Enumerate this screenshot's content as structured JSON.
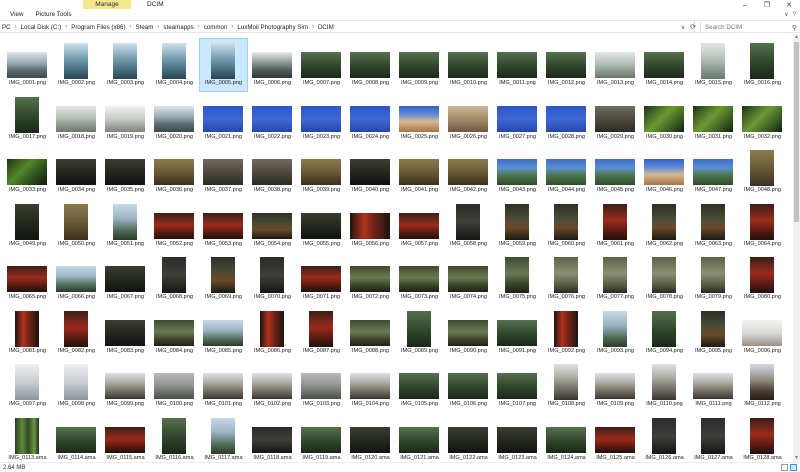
{
  "window": {
    "manage_tab": "Manage",
    "title": "DCIM",
    "minimize": "–",
    "maximize": "❐",
    "close": "✕"
  },
  "ribbon": {
    "tabs": [
      "View",
      "Picture Tools"
    ],
    "collapse": "∨",
    "help": "?"
  },
  "address": {
    "crumbs": [
      "PC",
      "Local Disk (C:)",
      "Program Files (x86)",
      "Steam",
      "steamapps",
      "common",
      "LuxMoil Photography Sim",
      "DCIM"
    ],
    "separator": "›",
    "dropdown": "∨",
    "refresh": "⟳"
  },
  "search": {
    "placeholder": "Search DCIM"
  },
  "status": {
    "text": "2.64 MB"
  },
  "files": [
    {
      "name": "IMG_0001.png",
      "theme": "city",
      "o": "land"
    },
    {
      "name": "IMG_0002.png",
      "theme": "water",
      "o": "port"
    },
    {
      "name": "IMG_0003.png",
      "theme": "water",
      "o": "port"
    },
    {
      "name": "IMG_0004.png",
      "theme": "water",
      "o": "port"
    },
    {
      "name": "IMG_0005.png",
      "theme": "water",
      "o": "port"
    },
    {
      "name": "IMG_0006.png",
      "theme": "dock",
      "o": "land"
    },
    {
      "name": "IMG_0007.png",
      "theme": "forest",
      "o": "land"
    },
    {
      "name": "IMG_0008.png",
      "theme": "forest",
      "o": "land"
    },
    {
      "name": "IMG_0009.png",
      "theme": "forest",
      "o": "land"
    },
    {
      "name": "IMG_0010.png",
      "theme": "forest",
      "o": "land"
    },
    {
      "name": "IMG_0011.png",
      "theme": "forest",
      "o": "land"
    },
    {
      "name": "IMG_0012.png",
      "theme": "forest",
      "o": "land"
    },
    {
      "name": "IMG_0013.png",
      "theme": "fog",
      "o": "land"
    },
    {
      "name": "IMG_0014.png",
      "theme": "forest",
      "o": "land"
    },
    {
      "name": "IMG_0015.png",
      "theme": "fog",
      "o": "port"
    },
    {
      "name": "IMG_0016.png",
      "theme": "forest",
      "o": "port"
    },
    {
      "name": "IMG_0017.png",
      "theme": "forest",
      "o": "port"
    },
    {
      "name": "IMG_0018.png",
      "theme": "fog",
      "o": "land"
    },
    {
      "name": "IMG_0019.png",
      "theme": "pale",
      "o": "land"
    },
    {
      "name": "IMG_0020.png",
      "theme": "city",
      "o": "land"
    },
    {
      "name": "IMG_0021.png",
      "theme": "blue",
      "o": "land"
    },
    {
      "name": "IMG_0022.png",
      "theme": "blue",
      "o": "land"
    },
    {
      "name": "IMG_0023.png",
      "theme": "blue",
      "o": "land"
    },
    {
      "name": "IMG_0024.png",
      "theme": "blue",
      "o": "land"
    },
    {
      "name": "IMG_0025.png",
      "theme": "beach",
      "o": "land"
    },
    {
      "name": "IMG_0026.png",
      "theme": "sand",
      "o": "land"
    },
    {
      "name": "IMG_0027.png",
      "theme": "blue",
      "o": "land"
    },
    {
      "name": "IMG_0028.png",
      "theme": "blue",
      "o": "land"
    },
    {
      "name": "IMG_0029.png",
      "theme": "ruins",
      "o": "land"
    },
    {
      "name": "IMG_0030.png",
      "theme": "palm",
      "o": "land"
    },
    {
      "name": "IMG_0031.png",
      "theme": "palm",
      "o": "land"
    },
    {
      "name": "IMG_0032.png",
      "theme": "palm",
      "o": "land"
    },
    {
      "name": "IMG_0033.png",
      "theme": "grass",
      "o": "land"
    },
    {
      "name": "IMG_0034.png",
      "theme": "dark",
      "o": "land"
    },
    {
      "name": "IMG_0035.png",
      "theme": "dark",
      "o": "land"
    },
    {
      "name": "IMG_0036.png",
      "theme": "dry",
      "o": "land"
    },
    {
      "name": "IMG_0037.png",
      "theme": "ruins",
      "o": "land"
    },
    {
      "name": "IMG_0038.png",
      "theme": "ruins",
      "o": "land"
    },
    {
      "name": "IMG_0039.png",
      "theme": "dry",
      "o": "land"
    },
    {
      "name": "IMG_0040.png",
      "theme": "dark",
      "o": "land"
    },
    {
      "name": "IMG_0041.png",
      "theme": "dry",
      "o": "land"
    },
    {
      "name": "IMG_0042.png",
      "theme": "dry",
      "o": "land"
    },
    {
      "name": "IMG_0043.png",
      "theme": "coast",
      "o": "land"
    },
    {
      "name": "IMG_0044.png",
      "theme": "coast",
      "o": "land"
    },
    {
      "name": "IMG_0045.png",
      "theme": "coast",
      "o": "land"
    },
    {
      "name": "IMG_0046.png",
      "theme": "beach",
      "o": "land"
    },
    {
      "name": "IMG_0047.png",
      "theme": "coast",
      "o": "land"
    },
    {
      "name": "IMG_0048.png",
      "theme": "dry",
      "o": "port"
    },
    {
      "name": "IMG_0049.png",
      "theme": "dark",
      "o": "port"
    },
    {
      "name": "IMG_0050.png",
      "theme": "dry",
      "o": "port"
    },
    {
      "name": "IMG_0051.png",
      "theme": "sky",
      "o": "port"
    },
    {
      "name": "IMG_0052.png",
      "theme": "torii",
      "o": "land"
    },
    {
      "name": "IMG_0053.png",
      "theme": "torii",
      "o": "land"
    },
    {
      "name": "IMG_0054.png",
      "theme": "shrine",
      "o": "land"
    },
    {
      "name": "IMG_0055.png",
      "theme": "dark",
      "o": "land"
    },
    {
      "name": "IMG_0056.png",
      "theme": "torii2",
      "o": "land"
    },
    {
      "name": "IMG_0057.png",
      "theme": "torii",
      "o": "land"
    },
    {
      "name": "IMG_0058.png",
      "theme": "night",
      "o": "port"
    },
    {
      "name": "IMG_0059.png",
      "theme": "shrine",
      "o": "port"
    },
    {
      "name": "IMG_0060.png",
      "theme": "shrine",
      "o": "port"
    },
    {
      "name": "IMG_0061.png",
      "theme": "torii",
      "o": "port"
    },
    {
      "name": "IMG_0062.png",
      "theme": "shrine",
      "o": "port"
    },
    {
      "name": "IMG_0063.png",
      "theme": "shrine",
      "o": "port"
    },
    {
      "name": "IMG_0064.png",
      "theme": "torii",
      "o": "port"
    },
    {
      "name": "IMG_0065.png",
      "theme": "torii",
      "o": "land"
    },
    {
      "name": "IMG_0066.png",
      "theme": "sky",
      "o": "land"
    },
    {
      "name": "IMG_0067.png",
      "theme": "dark",
      "o": "land"
    },
    {
      "name": "IMG_0068.png",
      "theme": "night",
      "o": "port"
    },
    {
      "name": "IMG_0069.png",
      "theme": "shrine",
      "o": "port"
    },
    {
      "name": "IMG_0070.png",
      "theme": "night",
      "o": "port"
    },
    {
      "name": "IMG_0071.png",
      "theme": "torii",
      "o": "land"
    },
    {
      "name": "IMG_0072.png",
      "theme": "moss",
      "o": "land"
    },
    {
      "name": "IMG_0073.png",
      "theme": "moss",
      "o": "land"
    },
    {
      "name": "IMG_0074.png",
      "theme": "moss",
      "o": "land"
    },
    {
      "name": "IMG_0075.png",
      "theme": "moss",
      "o": "port"
    },
    {
      "name": "IMG_0076.png",
      "theme": "statue",
      "o": "port"
    },
    {
      "name": "IMG_0077.png",
      "theme": "statue",
      "o": "port"
    },
    {
      "name": "IMG_0078.png",
      "theme": "statue",
      "o": "port"
    },
    {
      "name": "IMG_0079.png",
      "theme": "statue",
      "o": "port"
    },
    {
      "name": "IMG_0080.png",
      "theme": "torii",
      "o": "port"
    },
    {
      "name": "IMG_0081.png",
      "theme": "torii2",
      "o": "port"
    },
    {
      "name": "IMG_0082.png",
      "theme": "torii",
      "o": "port"
    },
    {
      "name": "IMG_0083.png",
      "theme": "dark",
      "o": "land"
    },
    {
      "name": "IMG_0084.png",
      "theme": "moss",
      "o": "land"
    },
    {
      "name": "IMG_0085.png",
      "theme": "sky",
      "o": "land"
    },
    {
      "name": "IMG_0086.png",
      "theme": "torii2",
      "o": "port"
    },
    {
      "name": "IMG_0087.png",
      "theme": "torii",
      "o": "port"
    },
    {
      "name": "IMG_0088.png",
      "theme": "moss",
      "o": "land"
    },
    {
      "name": "IMG_0089.png",
      "theme": "forest",
      "o": "port"
    },
    {
      "name": "IMG_0090.png",
      "theme": "moss",
      "o": "land"
    },
    {
      "name": "IMG_0091.png",
      "theme": "forest",
      "o": "land"
    },
    {
      "name": "IMG_0092.png",
      "theme": "torii2",
      "o": "port"
    },
    {
      "name": "IMG_0093.png",
      "theme": "sky",
      "o": "port"
    },
    {
      "name": "IMG_0094.png",
      "theme": "forest",
      "o": "port"
    },
    {
      "name": "IMG_0095.png",
      "theme": "shrine",
      "o": "port"
    },
    {
      "name": "IMG_0096.png",
      "theme": "sign",
      "o": "land"
    },
    {
      "name": "IMG_0097.png",
      "theme": "snow",
      "o": "port"
    },
    {
      "name": "IMG_0098.png",
      "theme": "snow",
      "o": "port"
    },
    {
      "name": "IMG_0099.png",
      "theme": "street",
      "o": "land"
    },
    {
      "name": "IMG_0100.png",
      "theme": "gray",
      "o": "land"
    },
    {
      "name": "IMG_0101.png",
      "theme": "street",
      "o": "land"
    },
    {
      "name": "IMG_0102.png",
      "theme": "street",
      "o": "land"
    },
    {
      "name": "IMG_0103.png",
      "theme": "gray",
      "o": "land"
    },
    {
      "name": "IMG_0104.png",
      "theme": "street",
      "o": "land"
    },
    {
      "name": "IMG_0105.png",
      "theme": "forest",
      "o": "land"
    },
    {
      "name": "IMG_0106.png",
      "theme": "forest",
      "o": "land"
    },
    {
      "name": "IMG_0107.png",
      "theme": "forest",
      "o": "land"
    },
    {
      "name": "IMG_0108.png",
      "theme": "street",
      "o": "port"
    },
    {
      "name": "IMG_0109.png",
      "theme": "street",
      "o": "land"
    },
    {
      "name": "IMG_0110.png",
      "theme": "street",
      "o": "port"
    },
    {
      "name": "IMG_0111.png",
      "theme": "street",
      "o": "land"
    },
    {
      "name": "IMG_0112.png",
      "theme": "pagoda",
      "o": "port"
    },
    {
      "name": "IMG_0113.ama",
      "theme": "bamboo",
      "o": "port"
    },
    {
      "name": "IMG_0114.ama",
      "theme": "forest",
      "o": "land"
    },
    {
      "name": "IMG_0115.ama",
      "theme": "torii",
      "o": "land"
    },
    {
      "name": "IMG_0116.ama",
      "theme": "forest",
      "o": "port"
    },
    {
      "name": "IMG_0117.ama",
      "theme": "sky",
      "o": "port"
    },
    {
      "name": "IMG_0118.ama",
      "theme": "night",
      "o": "land"
    },
    {
      "name": "IMG_0119.ama",
      "theme": "forest",
      "o": "land"
    },
    {
      "name": "IMG_0120.ama",
      "theme": "dark",
      "o": "land"
    },
    {
      "name": "IMG_0121.ama",
      "theme": "forest",
      "o": "land"
    },
    {
      "name": "IMG_0122.ama",
      "theme": "dark",
      "o": "land"
    },
    {
      "name": "IMG_0123.ama",
      "theme": "dark",
      "o": "land"
    },
    {
      "name": "IMG_0124.ama",
      "theme": "forest",
      "o": "land"
    },
    {
      "name": "IMG_0125.ama",
      "theme": "torii",
      "o": "land"
    },
    {
      "name": "IMG_0126.ama",
      "theme": "night",
      "o": "port"
    },
    {
      "name": "IMG_0127.ama",
      "theme": "night",
      "o": "port"
    },
    {
      "name": "IMG_0128.ama",
      "theme": "torii",
      "o": "port"
    }
  ],
  "selected_file": "IMG_0005.png"
}
